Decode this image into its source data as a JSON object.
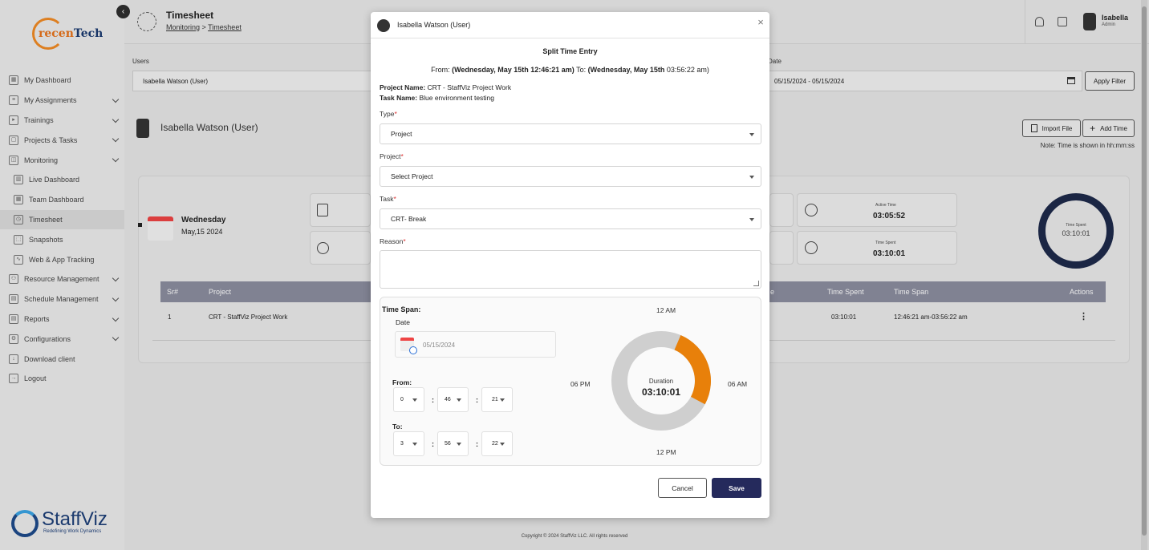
{
  "sidebar": {
    "logo_text_1": "recen",
    "logo_text_2": "Tech",
    "items": [
      {
        "label": "My Dashboard",
        "icon": "dashboard-icon",
        "chev": false,
        "sub": false
      },
      {
        "label": "My Assignments",
        "icon": "assignments-icon",
        "chev": true,
        "sub": false
      },
      {
        "label": "Trainings",
        "icon": "play-icon",
        "chev": true,
        "sub": false
      },
      {
        "label": "Projects & Tasks",
        "icon": "clipboard-icon",
        "chev": true,
        "sub": false
      },
      {
        "label": "Monitoring",
        "icon": "monitoring-icon",
        "chev": true,
        "sub": false
      },
      {
        "label": "Live Dashboard",
        "icon": "bar-chart-icon",
        "chev": false,
        "sub": true
      },
      {
        "label": "Team Dashboard",
        "icon": "grid-icon",
        "chev": false,
        "sub": true
      },
      {
        "label": "Timesheet",
        "icon": "clock-icon",
        "chev": false,
        "sub": true,
        "active": true
      },
      {
        "label": "Snapshots",
        "icon": "screenshot-icon",
        "chev": false,
        "sub": true
      },
      {
        "label": "Web & App Tracking",
        "icon": "tracking-icon",
        "chev": false,
        "sub": true
      },
      {
        "label": "Resource Management",
        "icon": "resource-icon",
        "chev": true,
        "sub": false
      },
      {
        "label": "Schedule Management",
        "icon": "schedule-icon",
        "chev": true,
        "sub": false
      },
      {
        "label": "Reports",
        "icon": "report-icon",
        "chev": true,
        "sub": false
      },
      {
        "label": "Configurations",
        "icon": "config-icon",
        "chev": true,
        "sub": false
      },
      {
        "label": "Download client",
        "icon": "download-icon",
        "chev": false,
        "sub": false
      },
      {
        "label": "Logout",
        "icon": "logout-icon",
        "chev": false,
        "sub": false
      }
    ],
    "brand_name": "StaffViz",
    "brand_tagline": "Redefining Work Dynamics"
  },
  "header": {
    "title": "Timesheet",
    "breadcrumb_1": "Monitoring",
    "breadcrumb_sep": " > ",
    "breadcrumb_2": "Timesheet",
    "user_name": "Isabella",
    "user_role": "Admin"
  },
  "filters": {
    "users_label": "Users",
    "users_value": "Isabella Watson (User)",
    "date_label": "Date",
    "date_value": "05/15/2024 - 05/15/2024",
    "apply_label": "Apply Filter"
  },
  "page": {
    "user_name": "Isabella Watson (User)",
    "import_label": "Import File",
    "add_time_label": "Add Time",
    "note": "Note: Time is shown in hh:mm:ss",
    "day_name": "Wednesday",
    "day_date": "May,15 2024",
    "active_time_label": "Active Time",
    "active_time_value": "03:05:52",
    "time_spent_label": "Time Spent",
    "time_spent_value": "03:10:01",
    "ring_label": "Time Spent",
    "ring_value": "03:10:01",
    "table_headers": [
      "Sr#",
      "Project",
      "e",
      "Time Spent",
      "Time Span",
      "Actions"
    ],
    "table_row": {
      "sr": "1",
      "project": "CRT - StaffViz Project Work",
      "time_spent": "03:10:01",
      "time_span": "12:46:21 am-03:56:22 am",
      "actions": "⋮"
    },
    "copyright": "Copyright © 2024 StaffViz LLC. All rights reserved"
  },
  "modal": {
    "user": "Isabella Watson (User)",
    "close": "×",
    "title": "Split Time Entry",
    "range_from_prefix": "From: ",
    "range_from": "(Wednesday, May 15th 12:46:21 am)",
    "range_to_prefix": " To: ",
    "range_to_bold": "(Wednesday, May 15th",
    "range_to_rest": " 03:56:22 am)",
    "project_name_label": "Project Name:",
    "project_name": " CRT - StaffViz Project Work",
    "task_name_label": "Task Name:",
    "task_name": " Blue environment testing",
    "type_label": "Type",
    "type_value": "Project",
    "project_label": "Project",
    "project_value": "Select Project",
    "task_label": "Task",
    "task_value": "CRT- Break",
    "reason_label": "Reason",
    "required_mark": "*",
    "time_span_label": "Time Span:",
    "date_label": "Date",
    "date_value": "05/15/2024",
    "from_label": "From:",
    "from_h": "0",
    "from_m": "46",
    "from_s": "21",
    "to_label": "To:",
    "to_h": "3",
    "to_m": "56",
    "to_s": "22",
    "colon": ":",
    "clock_top": "12 AM",
    "clock_right": "06 AM",
    "clock_bottom": "12 PM",
    "clock_left": "06 PM",
    "duration_label": "Duration",
    "duration_value": "03:10:01",
    "cancel_label": "Cancel",
    "save_label": "Save",
    "colors": {
      "span": "#e8800a",
      "track": "#cfcfcf",
      "save": "#252a5c"
    }
  },
  "duration_arc": {
    "start_hour": 0.7725,
    "end_hour": 3.9394
  }
}
